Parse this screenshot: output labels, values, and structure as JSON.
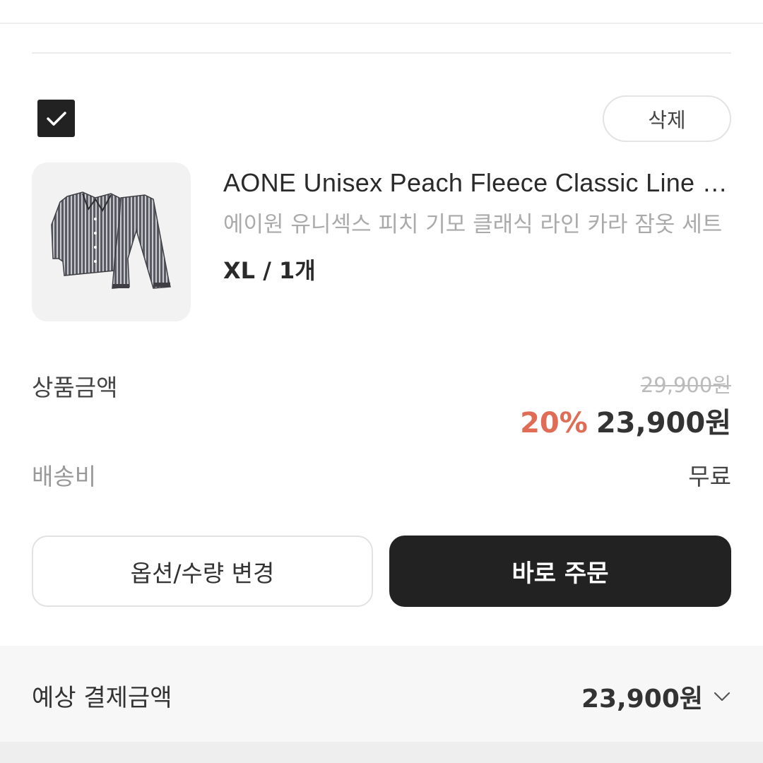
{
  "cart_item": {
    "selected": true,
    "delete_label": "삭제",
    "product_name": "AONE Unisex Peach Fleece Classic Line Collar Pajama Set",
    "product_name_ko": "에이원 유니섹스 피치 기모 클래식 라인 카라 잠옷 세트",
    "option": "XL / 1개",
    "image_icon": "striped-pajama-set-image"
  },
  "price": {
    "label": "상품금액",
    "original": "29,900원",
    "discount": "20%",
    "sale": "23,900원"
  },
  "shipping": {
    "label": "배송비",
    "value": "무료"
  },
  "actions": {
    "change_option_label": "옵션/수량 변경",
    "order_now_label": "바로 주문"
  },
  "summary": {
    "label": "예상 결제금액",
    "total": "23,900원",
    "expand_icon": "chevron-down-icon"
  },
  "colors": {
    "primary": "#222222",
    "discount": "#e06c56",
    "muted": "#aaaaaa",
    "summary_background": "#f7f7f7"
  }
}
